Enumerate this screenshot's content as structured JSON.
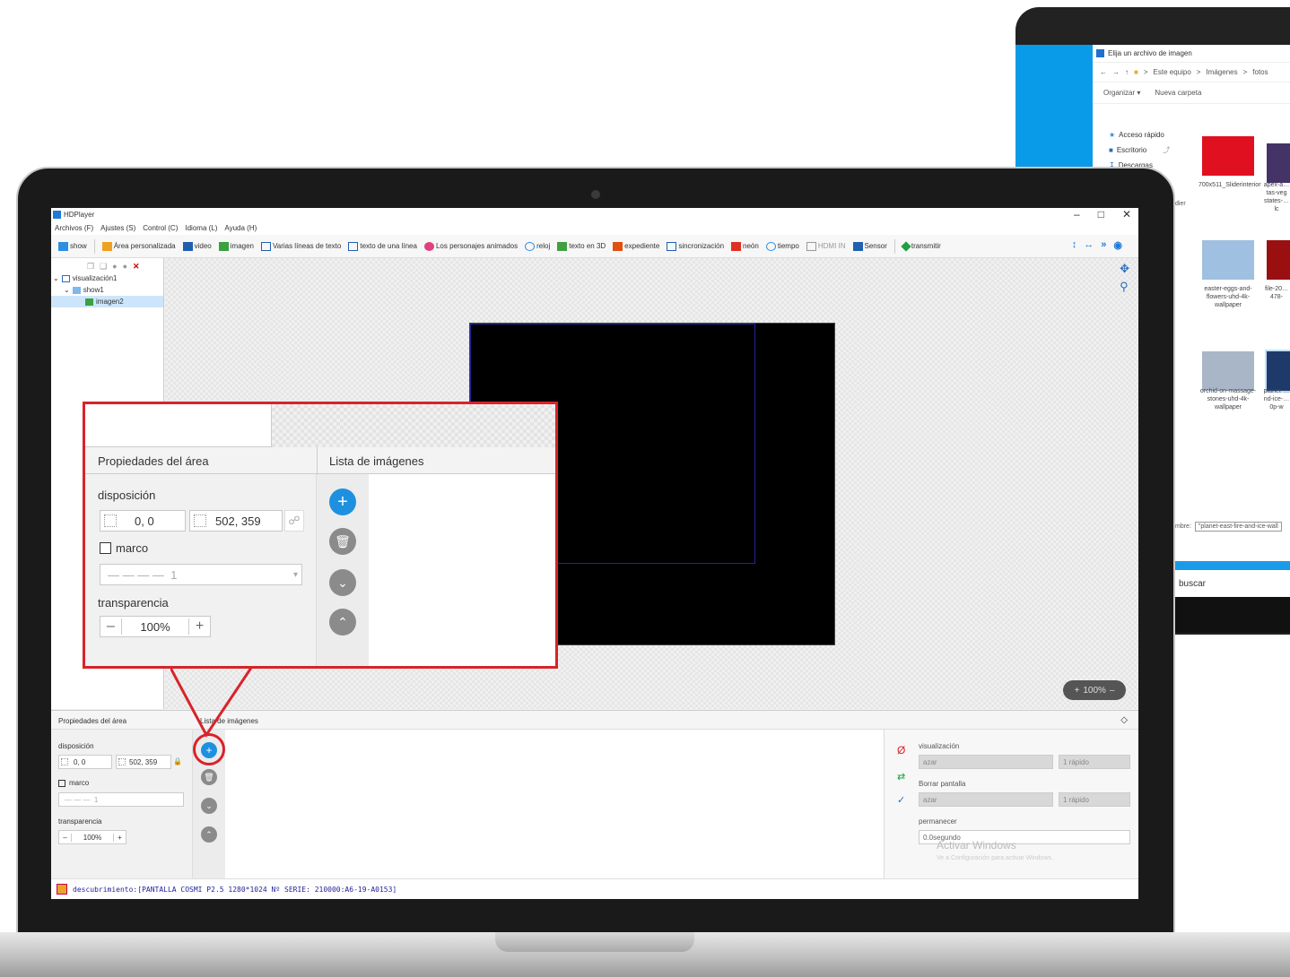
{
  "back_dialog": {
    "title": "Elija un archivo de imagen",
    "address": [
      "Este equipo",
      "Imágenes",
      "fotos"
    ],
    "toolbar": [
      "Organizar ▾",
      "Nueva carpeta"
    ],
    "nav": [
      "Acceso rápido",
      "Escritorio",
      "Descargas"
    ],
    "nav_extra": "dier",
    "thumbnails": [
      {
        "label": "700x511_Sliderinterior",
        "color": "#e01020"
      },
      {
        "label": "apex-a… tas-veg states-… lc",
        "color": "#443366"
      },
      {
        "label": "easter-eggs-and-flowers-uhd-4k-wallpaper",
        "color": "#9fc0e0"
      },
      {
        "label": "file-20… 478-",
        "color": "#9a1010"
      },
      {
        "label": "orchid-on-massage-stones-uhd-4k-wallpaper",
        "color": "#a9b6c8"
      },
      {
        "label": "planet-… nd-ice-… 0p-w",
        "color": "#1e3a6a"
      }
    ],
    "filename_label": "mbre:",
    "filename_value": "\"planet-east-fire-and-ice-wall",
    "search_text": "buscar"
  },
  "app": {
    "title": "HDPlayer",
    "window_controls": [
      "–",
      "□",
      "✕"
    ],
    "menu": [
      "Archivos (F)",
      "Ajustes (S)",
      "Control (C)",
      "Idioma (L)",
      "Ayuda (H)"
    ],
    "toolbar": [
      {
        "label": "show",
        "icon": "show-icon",
        "color": "#2c8ee0"
      },
      {
        "label": "Área personalizada",
        "icon": "custom-area-icon",
        "color": "#f0a020"
      },
      {
        "label": "video",
        "icon": "video-icon",
        "color": "#1f5fb0"
      },
      {
        "label": "imagen",
        "icon": "image-icon",
        "color": "#3aa040"
      },
      {
        "label": "Varias líneas de texto",
        "icon": "multiline-text-icon",
        "color": "#2060b0"
      },
      {
        "label": "texto de una línea",
        "icon": "single-line-text-icon",
        "color": "#2060b0"
      },
      {
        "label": "Los personajes animados",
        "icon": "animated-characters-icon",
        "color": "#e04080"
      },
      {
        "label": "reloj",
        "icon": "clock-icon",
        "color": "#2c8ee0"
      },
      {
        "label": "texto en 3D",
        "icon": "3d-text-icon",
        "color": "#40a040"
      },
      {
        "label": "expediente",
        "icon": "document-icon",
        "color": "#e05010"
      },
      {
        "label": "sincronización",
        "icon": "sync-icon",
        "color": "#2060b0"
      },
      {
        "label": "neón",
        "icon": "neon-icon",
        "color": "#e03020"
      },
      {
        "label": "tiempo",
        "icon": "weather-icon",
        "color": "#2c8ee0"
      },
      {
        "label": "HDMI IN",
        "icon": "hdmi-icon",
        "color": "#999999"
      },
      {
        "label": "Sensor",
        "icon": "sensor-icon",
        "color": "#2060b0"
      },
      {
        "label": "transmitir",
        "icon": "transmit-icon",
        "color": "#20a040"
      }
    ],
    "tree": [
      {
        "label": "visualización1",
        "level": 0
      },
      {
        "label": "show1",
        "level": 1
      },
      {
        "label": "imagen2",
        "level": 2
      }
    ],
    "zoom": "100%",
    "zoom_minus": "–",
    "zoom_plus": "+"
  },
  "panel": {
    "area_props_title": "Propiedades del área",
    "image_list_title": "Lista de imágenes",
    "layout_label": "disposición",
    "position_value": "0, 0",
    "size_value": "502, 359",
    "border_label": "marco",
    "border_value": "1",
    "transparency_label": "transparencia",
    "transparency_value": "100%",
    "minus": "–",
    "plus": "+"
  },
  "effects": {
    "display_label": "visualización",
    "display_value": "azar",
    "display_speed": "1 rápido",
    "clear_label": "Borrar pantalla",
    "clear_value": "azar",
    "clear_speed": "1 rápido",
    "stay_label": "permanecer",
    "stay_value": "0.0segundo",
    "watermark_title": "Activar Windows",
    "watermark_sub": "Ve a Configuración para activar Windows."
  },
  "status": {
    "text": "descubrimiento:[PANTALLA COSMI P2.5 1280*1024 Nº SERIE: 210000:A6-19-A0153]"
  },
  "colors": {
    "accent_blue": "#1e90e0",
    "callout_red": "#d8232a",
    "status_text": "#1f1f9a"
  }
}
